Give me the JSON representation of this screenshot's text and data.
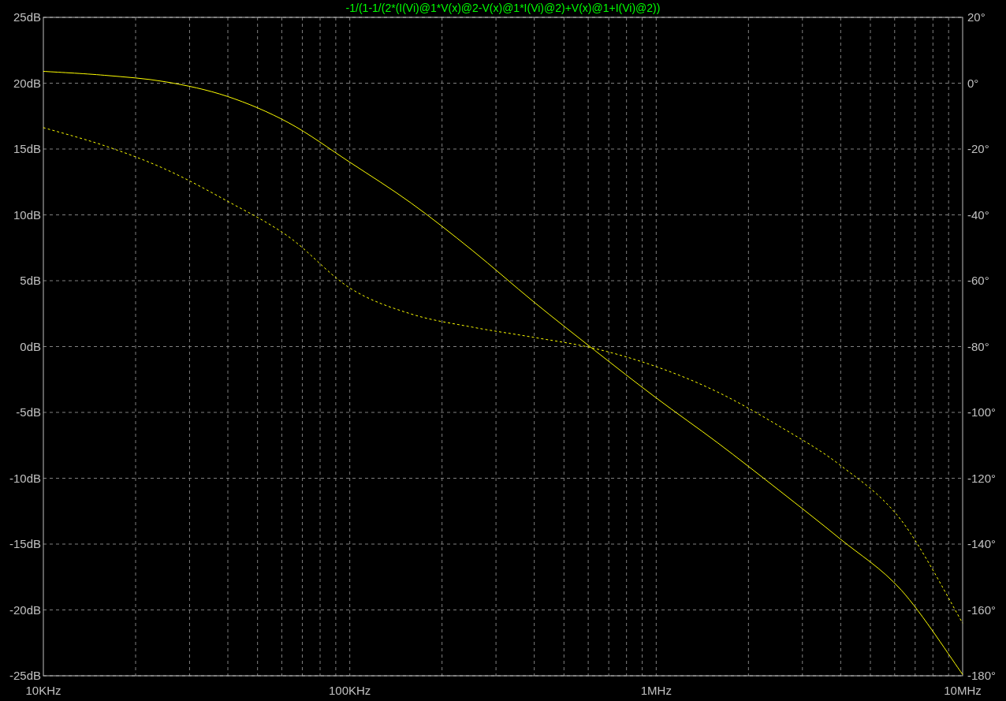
{
  "magnitude_plot": {
    "chart_data": {
      "type": "line",
      "title": "-1/(1-1/(2*(I(Vi)@1*V(x)@2-V(x)@1*I(Vi)@2)+V(x)@1+I(Vi)@2))",
      "ylim": [
        -25,
        25
      ],
      "grid": true,
      "categories": [
        "10KHz",
        null,
        null,
        null,
        null,
        "100KHz",
        null,
        null,
        null,
        null,
        "1MHz",
        null,
        null,
        null,
        null,
        "10MHz"
      ],
      "yticks": [
        {
          "value": 25,
          "label": "25dB"
        },
        {
          "value": 20,
          "label": "20dB"
        },
        {
          "value": 15,
          "label": "15dB"
        },
        {
          "value": 10,
          "label": "10dB"
        },
        {
          "value": 5,
          "label": "5dB"
        },
        {
          "value": 0,
          "label": "0dB"
        },
        {
          "value": -5,
          "label": "-5dB"
        },
        {
          "value": -10,
          "label": "-10dB"
        },
        {
          "value": -15,
          "label": "-15dB"
        },
        {
          "value": -20,
          "label": "-20dB"
        },
        {
          "value": -25,
          "label": "-25dB"
        }
      ],
      "series": [
        {
          "color": "#ffff00",
          "line_style": "solid",
          "values": [
            20.9,
            20.6,
            20.1,
            19.0,
            17.0,
            14.0,
            10.9,
            7.3,
            3.4,
            -0.3,
            -3.9,
            -7.3,
            -10.9,
            -14.6,
            -18.5,
            -24.9
          ]
        }
      ]
    }
  },
  "phase_plot": {
    "chart_data": {
      "type": "line",
      "ylim": [
        -180,
        20
      ],
      "categories": [
        null,
        null,
        null,
        null,
        null,
        null,
        null,
        null,
        null,
        null,
        null,
        null,
        null,
        null,
        null,
        null
      ],
      "yticks": [
        {
          "value": 20,
          "label": "20°"
        },
        {
          "value": 0,
          "label": "0°"
        },
        {
          "value": -20,
          "label": "-20°"
        },
        {
          "value": -40,
          "label": "-40°"
        },
        {
          "value": -60,
          "label": "-60°"
        },
        {
          "value": -80,
          "label": "-80°"
        },
        {
          "value": -100,
          "label": "-100°"
        },
        {
          "value": -120,
          "label": "-120°"
        },
        {
          "value": -140,
          "label": "-140°"
        },
        {
          "value": -160,
          "label": "-160°"
        },
        {
          "value": -180,
          "label": "-180°"
        }
      ],
      "series": [
        {
          "color": "#ffff00",
          "line_style": "dashed",
          "values": [
            -13.5,
            -19.0,
            -26.2,
            -35.8,
            -46.6,
            -62.2,
            -70.1,
            -74.1,
            -77.2,
            -80.6,
            -86.1,
            -93.8,
            -104.1,
            -116.0,
            -132.8,
            -164.0
          ]
        }
      ]
    }
  }
}
